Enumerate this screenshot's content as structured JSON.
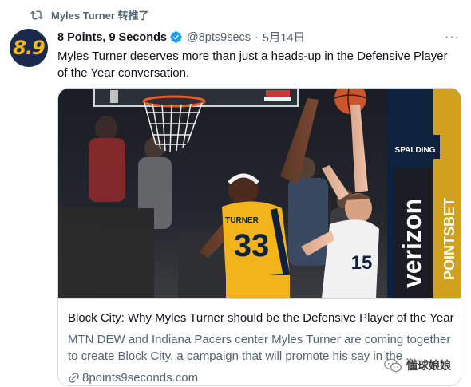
{
  "retweet": {
    "text": "Myles Turner 转推了",
    "icon": "retweet-icon"
  },
  "avatar": {
    "text": "8.9",
    "bg": "#1b2a4a",
    "fg": "#f5b81c"
  },
  "author": {
    "display_name": "8 Points, 9 Seconds",
    "handle": "@8pts9secs",
    "separator": "·",
    "date": "5月14日",
    "verified_color": "#1d9bf0"
  },
  "more": {
    "label": "···"
  },
  "tweet": {
    "text": "Myles Turner deserves more than just a heads-up in the Defensive Player of the Year conversation."
  },
  "card": {
    "title": "Block City: Why Myles Turner should be the Defensive Player of the Year",
    "description": "MTN DEW and Indiana Pacers center Myles Turner are coming together to create Block City, a campaign that will promote his say in the ...",
    "domain": "8points9seconds.com",
    "image_text": {
      "jersey_name": "TURNER",
      "jersey_number": "33",
      "sponsor_top": "SPALDING",
      "sponsor_1": "verizon",
      "sponsor_2": "POINTSBET",
      "opponent_number": "15"
    }
  },
  "watermark": {
    "text": "懂球娘娘"
  },
  "colors": {
    "text": "#0f1419",
    "secondary": "#536471",
    "border": "#cfd9de",
    "pacers_gold": "#f2b31b",
    "pacers_navy": "#0e2240"
  }
}
